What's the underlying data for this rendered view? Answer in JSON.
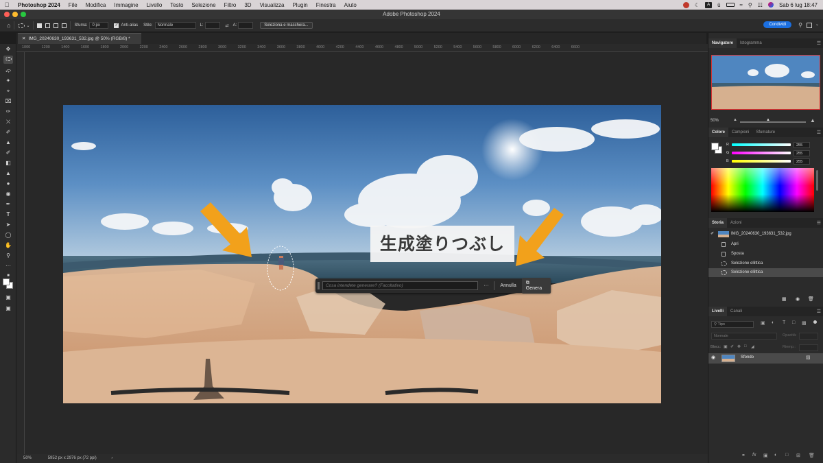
{
  "menubar": {
    "app": "Photoshop 2024",
    "items": [
      "File",
      "Modifica",
      "Immagine",
      "Livello",
      "Testo",
      "Selezione",
      "Filtro",
      "3D",
      "Visualizza",
      "Plugin",
      "Finestra",
      "Aiuto"
    ],
    "clock": "Sab 6 lug  18:47"
  },
  "window": {
    "title": "Adobe Photoshop 2024"
  },
  "options": {
    "feather_label": "Sfuma:",
    "feather_value": "0 px",
    "antialias_label": "Anti-alias",
    "style_label": "Stile:",
    "style_value": "Normale",
    "width_label": "L:",
    "height_label": "A:",
    "select_mask_label": "Seleziona e maschera...",
    "share_label": "Condividi"
  },
  "document": {
    "tab_title": "IMG_20240630_193631_532.jpg @ 50% (RGB/8) *",
    "zoom": "50%",
    "dimensions": "5952 px x 2976 px (72 ppi)"
  },
  "ruler": {
    "h_ticks": [
      "1000",
      "1200",
      "1400",
      "1600",
      "1800",
      "2000",
      "2200",
      "2400",
      "2600",
      "2800",
      "3000",
      "3200",
      "3400",
      "3600",
      "3800",
      "4000",
      "4200",
      "4400",
      "4600",
      "4800",
      "5000",
      "5200",
      "5400",
      "5600",
      "5800",
      "6000",
      "6200",
      "6400",
      "6600"
    ]
  },
  "contextual_bar": {
    "prompt_placeholder": "Cosa intendete generare? (Facoltativo)",
    "more": "···",
    "cancel_label": "Annulla",
    "generate_label": "Genera"
  },
  "overlay": {
    "caption": "生成塗りつぶし"
  },
  "navigator": {
    "tabs": [
      "Navigatore",
      "Istogramma"
    ],
    "zoom": "50%"
  },
  "color_panel": {
    "tabs": [
      "Colore",
      "Campioni",
      "Sfumature"
    ],
    "channels": [
      {
        "label": "R",
        "value": "255"
      },
      {
        "label": "G",
        "value": "255"
      },
      {
        "label": "B",
        "value": "255"
      }
    ]
  },
  "history_panel": {
    "tabs": [
      "Storia",
      "Azioni"
    ],
    "snapshot": "IMG_20240630_193631_532.jpg",
    "states": [
      "Apri",
      "Sposta",
      "Selezione ellittica",
      "Selezione ellittica"
    ]
  },
  "layers_panel": {
    "tabs": [
      "Livelli",
      "Canali"
    ],
    "filter_label": "Tipo",
    "blend_mode": "Normale",
    "opacity_label": "Opacità:",
    "lock_label": "Blocc:",
    "fill_label": "Riemp.:",
    "layers": [
      {
        "name": "Sfondo"
      }
    ]
  },
  "colors": {
    "accent": "#1b6fe0",
    "arrow": "#f2a11b",
    "panel": "#2b2b2b",
    "canvas": "#282828"
  }
}
